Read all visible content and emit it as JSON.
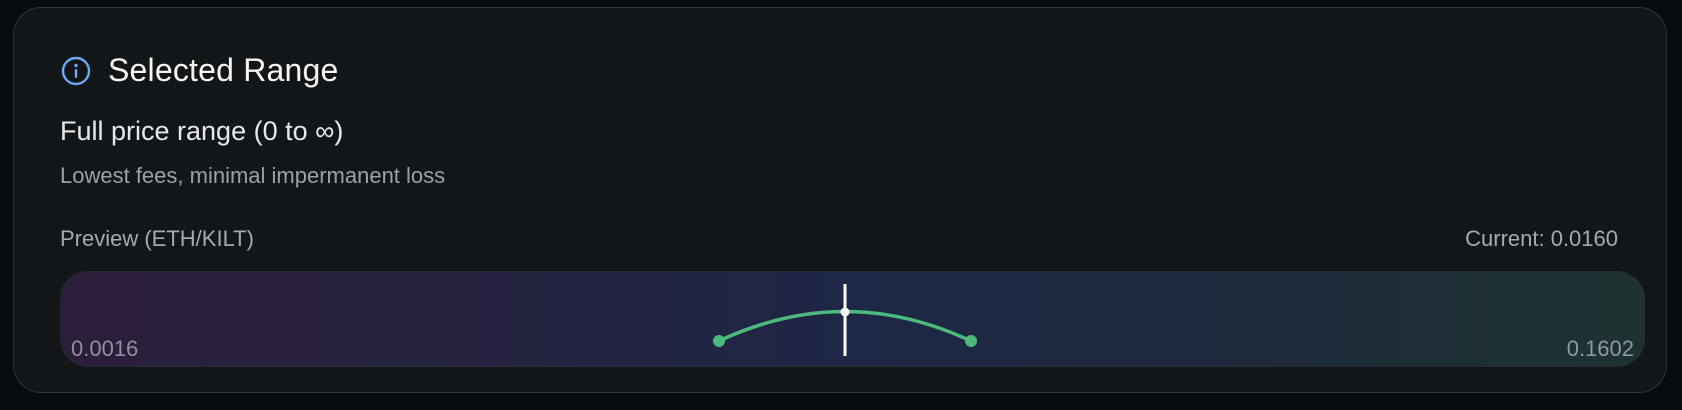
{
  "card": {
    "title": "Selected Range",
    "icon": "info-icon",
    "range_name": "Full price range (0 to ∞)",
    "range_description": "Lowest fees, minimal impermanent loss",
    "preview_label": "Preview (ETH/KILT)",
    "current_label": "Current: 0.0160",
    "min_price": "0.0016",
    "max_price": "0.1602"
  },
  "colors": {
    "accent_icon": "#6ea8f0",
    "curve": "#4cba7c",
    "current_marker": "#ffffff",
    "card_bg": "#131618"
  }
}
